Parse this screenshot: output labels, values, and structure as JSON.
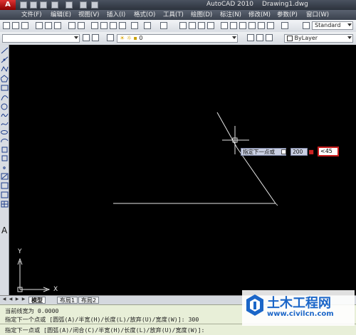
{
  "window": {
    "app_title": "AutoCAD 2010",
    "file_name": "Drawing1.dwg"
  },
  "menu": [
    "文件(F)",
    "编辑(E)",
    "视图(V)",
    "插入(I)",
    "格式(O)",
    "工具(T)",
    "绘图(D)",
    "标注(N)",
    "修改(M)",
    "参数(P)",
    "窗口(W)"
  ],
  "toolbar": {
    "text_style": "Standard",
    "layer_value": "0",
    "color_value": "ByLayer"
  },
  "dynamic_input": {
    "prompt": "指定下一点或",
    "length_value": "200",
    "angle_value": "<45"
  },
  "ucs": {
    "x_label": "X",
    "y_label": "Y"
  },
  "layout_tabs": [
    "模型",
    "布局1",
    "布局2"
  ],
  "command_line": [
    "当前线宽为 0.0000",
    "指定下一个点或 [圆弧(A)/半宽(H)/长度(L)/放弃(U)/宽度(W)]: 300",
    "指定下一点或 [圆弧(A)/闭合(C)/半宽(H)/长度(L)/放弃(U)/宽度(W)]:"
  ],
  "watermark": {
    "title": "土木工程网",
    "url": "www.civilcn.com"
  },
  "colors": {
    "canvas": "#000000",
    "command_bg": "#e8efd8",
    "angle_border": "#c81e1e",
    "watermark": "#1b66c8"
  }
}
